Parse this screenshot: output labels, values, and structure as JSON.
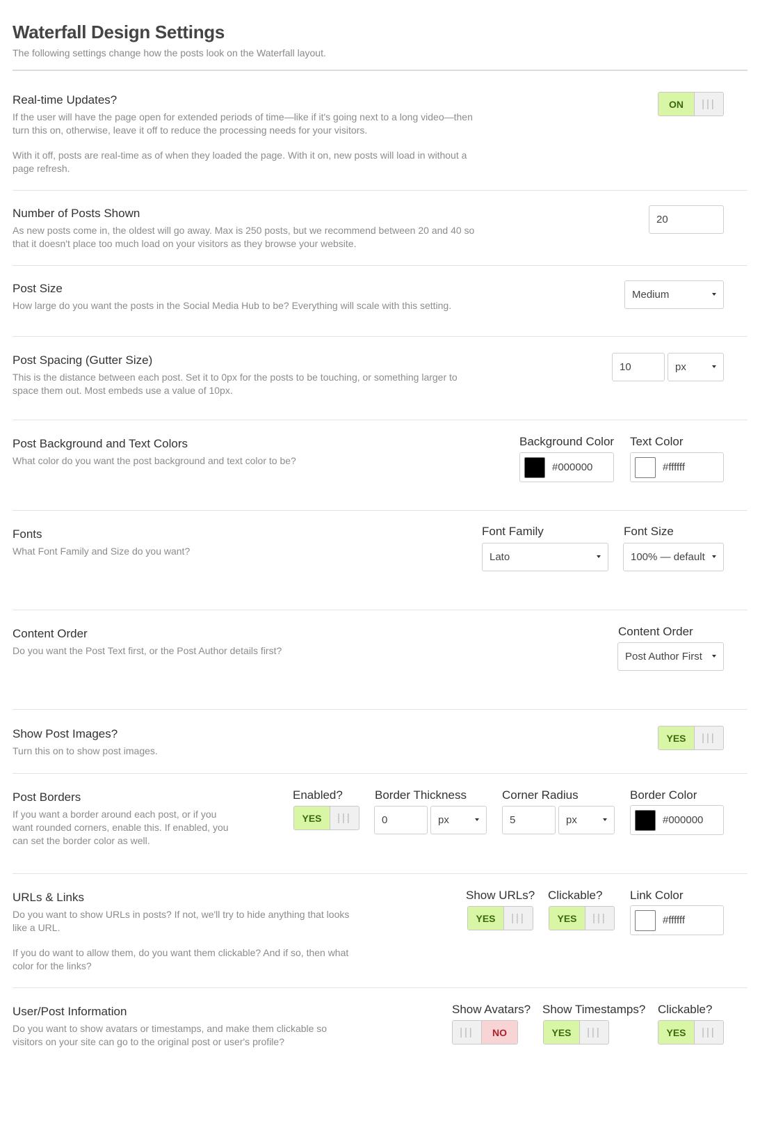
{
  "header": {
    "title": "Waterfall Design Settings",
    "subtitle": "The following settings change how the posts look on the Waterfall layout."
  },
  "toggle_grip": "|||",
  "realtime": {
    "title": "Real-time Updates?",
    "desc1": "If the user will have the page open for extended periods of time—like if it's going next to a long video—then turn this on, otherwise, leave it off to reduce the processing needs for your visitors.",
    "desc2": "With it off, posts are real-time as of when they loaded the page. With it on, new posts will load in without a page refresh.",
    "toggle": "ON"
  },
  "num_posts": {
    "title": "Number of Posts Shown",
    "desc": "As new posts come in, the oldest will go away. Max is 250 posts, but we recommend between 20 and 40 so that it doesn't place too much load on your visitors as they browse your website.",
    "value": "20"
  },
  "post_size": {
    "title": "Post Size",
    "desc": "How large do you want the posts in the Social Media Hub to be? Everything will scale with this setting.",
    "selected": "Medium"
  },
  "spacing": {
    "title": "Post Spacing (Gutter Size)",
    "desc": "This is the distance between each post. Set it to 0px for the posts to be touching, or something larger to space them out. Most embeds use a value of 10px.",
    "value": "10",
    "unit": "px"
  },
  "colors": {
    "title": "Post Background and Text Colors",
    "desc": "What color do you want the post background and text color to be?",
    "bg_label": "Background Color",
    "bg_value": "#000000",
    "text_label": "Text Color",
    "text_value": "#ffffff"
  },
  "fonts": {
    "title": "Fonts",
    "desc": "What Font Family and Size do you want?",
    "family_label": "Font Family",
    "family_value": "Lato",
    "size_label": "Font Size",
    "size_value": "100% — default"
  },
  "content_order": {
    "title": "Content Order",
    "desc": "Do you want the Post Text first, or the Post Author details first?",
    "label": "Content Order",
    "value": "Post Author First"
  },
  "images": {
    "title": "Show Post Images?",
    "desc": "Turn this on to show post images.",
    "toggle": "YES"
  },
  "borders": {
    "title": "Post Borders",
    "desc": "If you want a border around each post, or if you want rounded corners, enable this. If enabled, you can set the border color as well.",
    "enabled_label": "Enabled?",
    "enabled_toggle": "YES",
    "thickness_label": "Border Thickness",
    "thickness_value": "0",
    "thickness_unit": "px",
    "radius_label": "Corner Radius",
    "radius_value": "5",
    "radius_unit": "px",
    "color_label": "Border Color",
    "color_value": "#000000"
  },
  "urls": {
    "title": "URLs & Links",
    "desc1": "Do you want to show URLs in posts? If not, we'll try to hide anything that looks like a URL.",
    "desc2": "If you do want to allow them, do you want them clickable? And if so, then what color for the links?",
    "show_label": "Show URLs?",
    "show_toggle": "YES",
    "clickable_label": "Clickable?",
    "clickable_toggle": "YES",
    "color_label": "Link Color",
    "color_value": "#ffffff"
  },
  "userinfo": {
    "title": "User/Post Information",
    "desc": "Do you want to show avatars or timestamps, and make them clickable so visitors on your site can go to the original post or user's profile?",
    "avatars_label": "Show Avatars?",
    "avatars_toggle": "NO",
    "timestamps_label": "Show Timestamps?",
    "timestamps_toggle": "YES",
    "clickable_label": "Clickable?",
    "clickable_toggle": "YES"
  }
}
